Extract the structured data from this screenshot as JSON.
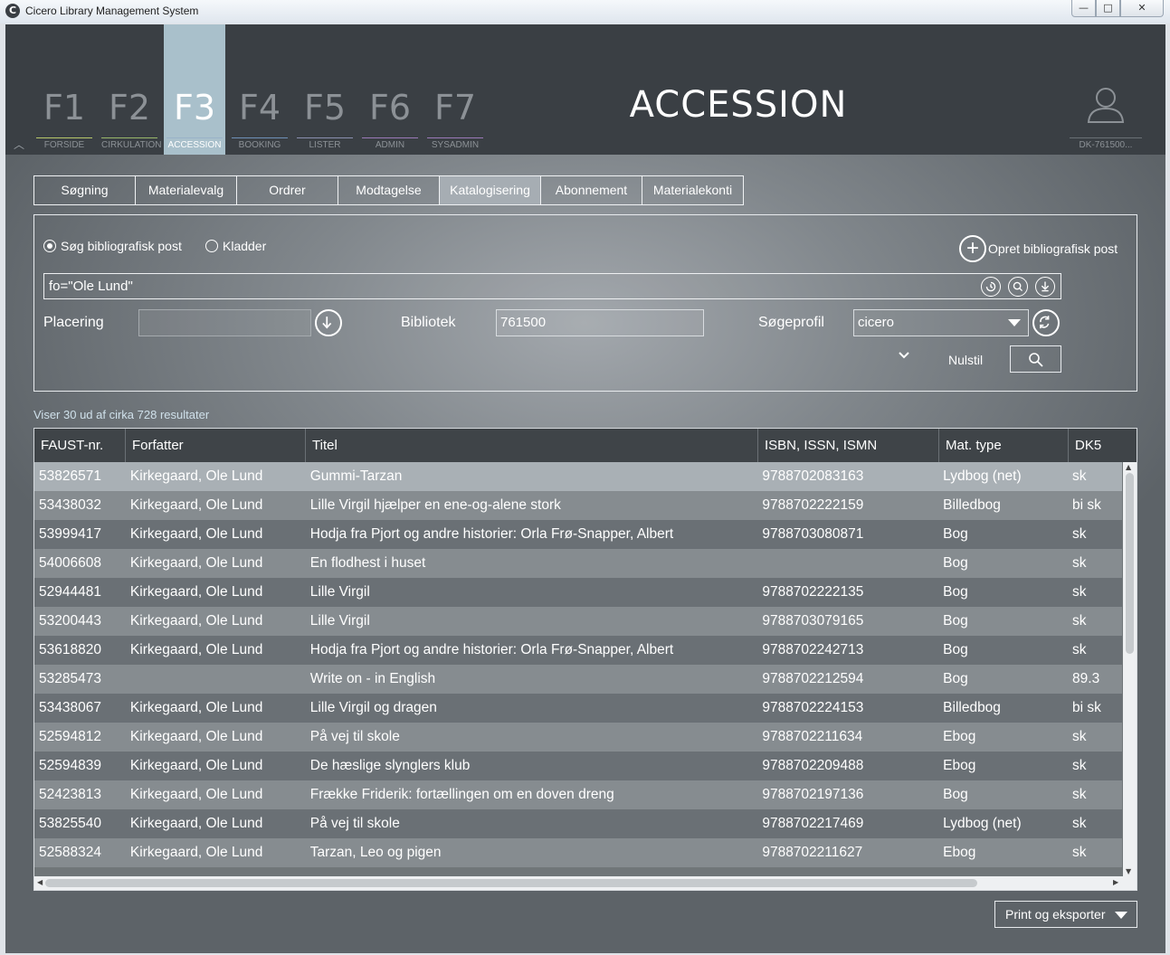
{
  "window": {
    "title": "Cicero Library Management System",
    "icon_letter": "C",
    "minimize_glyph": "—",
    "maximize_glyph": "□",
    "close_glyph": "✕"
  },
  "header": {
    "page_title": "ACCESSION",
    "user_label": "DK-761500...",
    "fkeys": [
      {
        "key": "F1",
        "label": "FORSIDE"
      },
      {
        "key": "F2",
        "label": "CIRKULATION"
      },
      {
        "key": "F3",
        "label": "ACCESSION"
      },
      {
        "key": "F4",
        "label": "BOOKING"
      },
      {
        "key": "F5",
        "label": "LISTER"
      },
      {
        "key": "F6",
        "label": "ADMIN"
      },
      {
        "key": "F7",
        "label": "SYSADMIN"
      }
    ],
    "active_fkey": "F3"
  },
  "subtabs": [
    "Søgning",
    "Materialevalg",
    "Ordrer",
    "Modtagelse",
    "Katalogisering",
    "Abonnement",
    "Materialekonti"
  ],
  "active_subtab": "Katalogisering",
  "search": {
    "radio_bib": "Søg bibliografisk post",
    "radio_draft": "Kladder",
    "create_label": "Opret bibliografisk post",
    "query": "fo=\"Ole Lund\"",
    "placering_label": "Placering",
    "placering_value": "",
    "bibliotek_label": "Bibliotek",
    "bibliotek_value": "761500",
    "profil_label": "Søgeprofil",
    "profil_value": "cicero",
    "reset_label": "Nulstil"
  },
  "results": {
    "count_text": "Viser 30 ud af cirka 728 resultater",
    "columns": [
      "FAUST-nr.",
      "Forfatter",
      "Titel",
      "ISBN, ISSN, ISMN",
      "Mat. type",
      "DK5"
    ],
    "rows": [
      [
        "53826571",
        "Kirkegaard, Ole Lund",
        "Gummi-Tarzan",
        "9788702083163",
        "Lydbog (net)",
        "sk"
      ],
      [
        "53438032",
        "Kirkegaard, Ole Lund",
        "Lille Virgil hjælper en ene-og-alene stork",
        "9788702222159",
        "Billedbog",
        "bi sk"
      ],
      [
        "53999417",
        "Kirkegaard, Ole Lund",
        "Hodja fra Pjort og andre historier: Orla Frø-Snapper, Albert",
        "9788703080871",
        "Bog",
        "sk"
      ],
      [
        "54006608",
        "Kirkegaard, Ole Lund",
        "En flodhest i huset",
        "",
        "Bog",
        "sk"
      ],
      [
        "52944481",
        "Kirkegaard, Ole Lund",
        "Lille Virgil",
        "9788702222135",
        "Bog",
        "sk"
      ],
      [
        "53200443",
        "Kirkegaard, Ole Lund",
        "Lille Virgil",
        "9788703079165",
        "Bog",
        "sk"
      ],
      [
        "53618820",
        "Kirkegaard, Ole Lund",
        "Hodja fra Pjort og andre historier: Orla Frø-Snapper, Albert",
        "9788702242713",
        "Bog",
        "sk"
      ],
      [
        "53285473",
        "",
        "Write on - in English",
        "9788702212594",
        "Bog",
        "89.3"
      ],
      [
        "53438067",
        "Kirkegaard, Ole Lund",
        "Lille Virgil og dragen",
        "9788702224153",
        "Billedbog",
        "bi sk"
      ],
      [
        "52594812",
        "Kirkegaard, Ole Lund",
        "På vej til skole",
        "9788702211634",
        "Ebog",
        "sk"
      ],
      [
        "52594839",
        "Kirkegaard, Ole Lund",
        "De hæslige slynglers klub",
        "9788702209488",
        "Ebog",
        "sk"
      ],
      [
        "52423813",
        "Kirkegaard, Ole Lund",
        "Frække Friderik: fortællingen om en doven dreng",
        "9788702197136",
        "Bog",
        "sk"
      ],
      [
        "53825540",
        "Kirkegaard, Ole Lund",
        "På vej til skole",
        "9788702217469",
        "Lydbog (net)",
        "sk"
      ],
      [
        "52588324",
        "Kirkegaard, Ole Lund",
        "Tarzan, Leo og pigen",
        "9788702211627",
        "Ebog",
        "sk"
      ]
    ]
  },
  "export_label": "Print og eksporter"
}
